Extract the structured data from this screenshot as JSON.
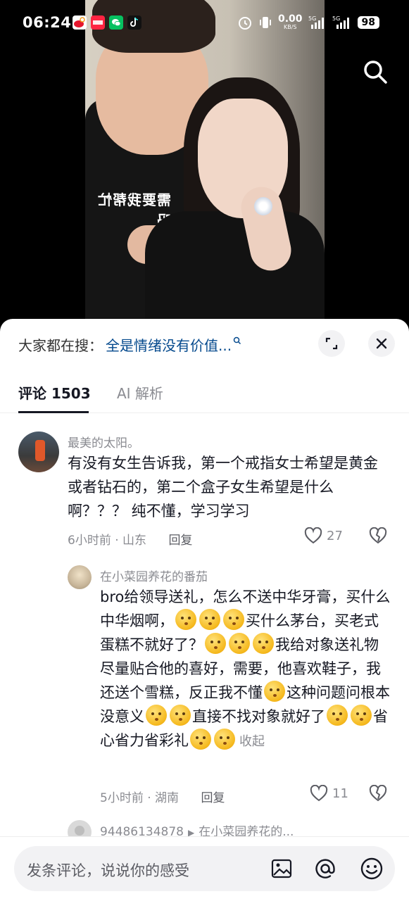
{
  "status_bar": {
    "time": "06:24",
    "network_speed": "0.00",
    "network_unit": "KB/S",
    "battery": "98",
    "app_icons": [
      "weibo-icon",
      "xiaohongshu-icon",
      "wechat-icon",
      "douyin-icon"
    ]
  },
  "video": {
    "shirt_text": "需要我帮忙吗"
  },
  "search_suggestion": {
    "label": "大家都在搜：",
    "query": "全是情绪没有价值..."
  },
  "tabs": [
    {
      "label": "评论 1503",
      "active": true
    },
    {
      "label": "AI 解析",
      "active": false
    }
  ],
  "comments": [
    {
      "username": "最美的太阳。",
      "text": "有没有女生告诉我，第一个戒指女士希望是黄金或者钻石的，第二个盒子女生希望是什么啊？？？ 纯不懂，学习学习",
      "meta": "6小时前 · 山东",
      "reply_label": "回复",
      "likes": "27"
    },
    {
      "username": "在小菜园养花的番茄",
      "text_parts": {
        "p1": "bro给领导送礼，怎么不送中华牙膏，买什么中华烟啊，",
        "p2": "买什么茅台，买老式蛋糕不就好了？",
        "p3": "我给对象送礼物尽量贴合他的喜好，需要，他喜欢鞋子，我还送个雪糕，反正我不懂",
        "p4": "这种问题问根本没意义",
        "p5": "直接不找对象就好了",
        "p6": "省心省力省彩礼"
      },
      "collapse_label": "收起",
      "meta": "5小时前 · 湖南",
      "reply_label": "回复",
      "likes": "11"
    },
    {
      "username": "94486134878",
      "reply_to": "在小菜园养花的..."
    }
  ],
  "input": {
    "placeholder": "发条评论，说说你的感受"
  },
  "colors": {
    "accent_link": "#04498d",
    "text_primary": "#161823",
    "text_secondary": "#8a8b91"
  }
}
